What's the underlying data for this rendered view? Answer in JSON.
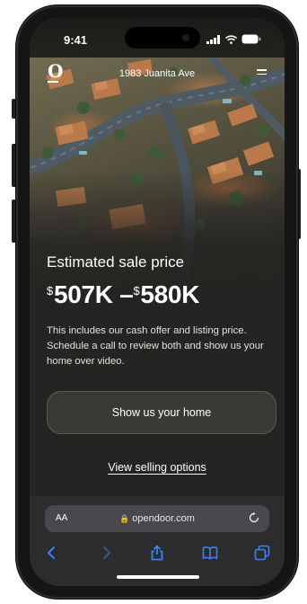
{
  "status_bar": {
    "time": "9:41"
  },
  "header": {
    "logo": "O",
    "address": "1983 Juanita Ave"
  },
  "estimate": {
    "label": "Estimated sale price",
    "currency": "$",
    "low": "507K",
    "separator": "–",
    "high": "580K",
    "description": "This includes our cash offer and listing price. Schedule a call to review both and show us your home over video."
  },
  "actions": {
    "primary_label": "Show us your home",
    "secondary_label": "View selling options"
  },
  "browser": {
    "text_size_label": "AA",
    "url": "opendoor.com"
  },
  "colors": {
    "background": "#252422",
    "button": "#3b3935",
    "browser_chrome": "#2c2c2e",
    "toolbar_icons": "#3b82f6"
  },
  "icons": [
    "signal-icon",
    "wifi-icon",
    "battery-icon",
    "menu-icon",
    "lock-icon",
    "reload-icon",
    "back-icon",
    "forward-icon",
    "share-icon",
    "bookmarks-icon",
    "tabs-icon"
  ]
}
